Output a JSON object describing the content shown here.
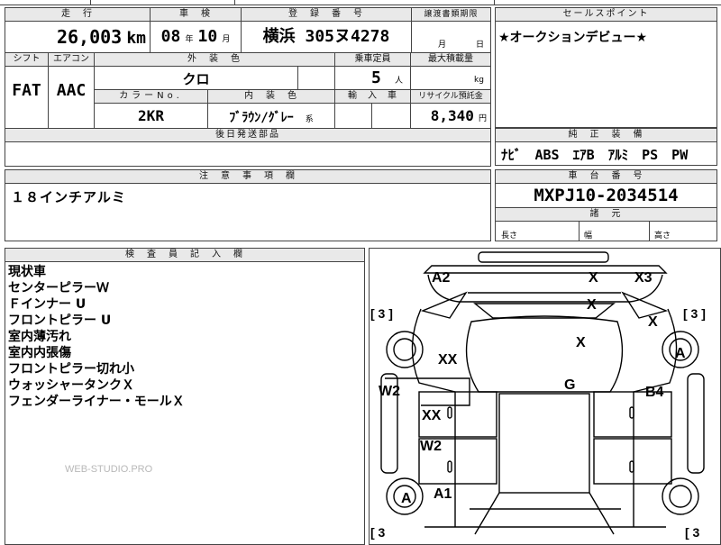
{
  "top_row": {
    "mileage_h": "走　行",
    "inspection_h": "車　検",
    "reg_h": "登　録　番　号",
    "transfer_h": "譲渡書類期限",
    "mileage_value": "26,003",
    "mileage_unit": "km",
    "inspection_year": "08",
    "inspection_year_unit": "年",
    "inspection_month": "10",
    "inspection_month_unit": "月",
    "reg_value": "横浜 305ヌ4278",
    "transfer_month": "月",
    "transfer_day": "日"
  },
  "sale_point": {
    "header": "セールスポイント",
    "text": "★オークションデビュー★"
  },
  "spec_row": {
    "shift_h": "シフト",
    "aircon_h": "エアコン",
    "exterior_h": "外　装　色",
    "capacity_h": "乗車定員",
    "load_h": "最大積載量",
    "shift_value": "FAT",
    "aircon_value": "AAC",
    "exterior_value": "クロ",
    "capacity_value": "5",
    "capacity_unit": "人",
    "load_unit": "kg",
    "color_no_h": "カラーNo.",
    "interior_h": "内　装　色",
    "import_h": "輸　入　車",
    "recycle_h": "リサイクル預託金",
    "color_no_value": "2KR",
    "interior_value": "ﾌﾞﾗｳﾝ/ｸﾞﾚｰ",
    "interior_suffix": "系",
    "recycle_value": "8,340",
    "recycle_unit": "円",
    "later_parts_h": "後日発送部品"
  },
  "equipment": {
    "header": "純　正　装　備",
    "value": "ﾅﾋﾞ　ABS　ｴｱB　ｱﾙﾐ　PS　PW"
  },
  "caution": {
    "header": "注　意　事　項　欄",
    "text": "１８インチアルミ"
  },
  "chassis": {
    "header": "車　台　番　号",
    "value": "MXPJ10-2034514",
    "dims_header": "諸　元",
    "length_label": "長さ",
    "width_label": "幅",
    "height_label": "高さ"
  },
  "inspector": {
    "header": "検　査　員　記　入　欄",
    "lines": [
      "現状車",
      "センターピラーＷ",
      "Ｆインナー U",
      "フロントピラー U",
      "室内薄汚れ",
      "室内内張傷",
      "フロントピラー切れ小",
      "ウォッシャータンクＸ",
      "フェンダーライナー・モールＸ"
    ]
  },
  "diagram_marks": {
    "a2": "A2",
    "x_top": "X",
    "x3": "X3",
    "x_roof": "X",
    "x_right_fender": "X",
    "x_center": "X",
    "xx_left_front": "XX",
    "w2_left": "W2",
    "g_center": "G",
    "b4_right": "B4",
    "xx_left_door": "XX",
    "w2_left_rear": "W2",
    "a_left_wheel": "A",
    "a1_left": "A1",
    "a_right_wheel": "A",
    "bracket_tl": "[ 3 ]",
    "bracket_tr": "[ 3 ]",
    "bracket_bl": "[ 3",
    "bracket_br": "[ 3"
  },
  "watermark": "WEB-STUDIO.PRO"
}
